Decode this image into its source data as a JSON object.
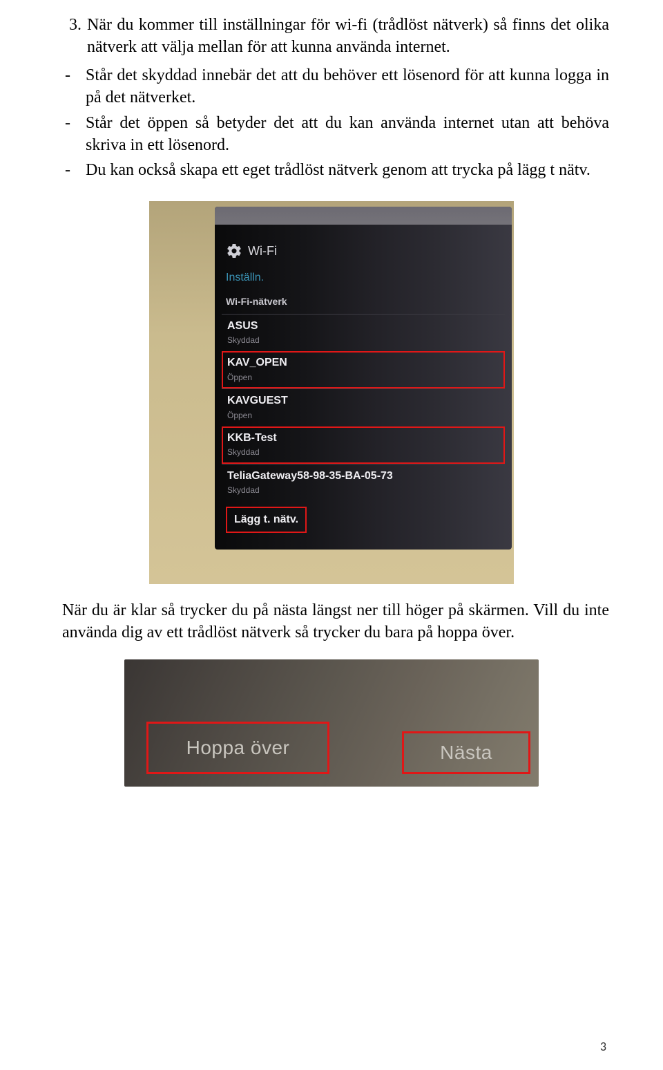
{
  "list": {
    "number": "3.",
    "item3_text": "När du kommer till inställningar för wi-fi (trådlöst nätverk) så finns det olika nätverk att välja mellan för att kunna använda internet.",
    "dash": "-",
    "bullet1": "Står det skyddad innebär det att du behöver ett lösenord för att kunna logga in på det nätverket.",
    "bullet2": "Står det öppen så betyder det att du kan använda internet utan att behöva skriva in ett lösenord.",
    "bullet3": "Du kan också skapa ett eget trådlöst nätverk genom att trycka på lägg t nätv."
  },
  "phone": {
    "wifi_title": "Wi-Fi",
    "install": "Inställn.",
    "section": "Wi-Fi-nätverk",
    "networks": [
      {
        "name": "ASUS",
        "status": "Skyddad"
      },
      {
        "name": "KAV_OPEN",
        "status": "Öppen"
      },
      {
        "name": "KAVGUEST",
        "status": "Öppen"
      },
      {
        "name": "KKB-Test",
        "status": "Skyddad"
      },
      {
        "name": "TeliaGateway58-98-35-BA-05-73",
        "status": "Skyddad"
      }
    ],
    "add_label": "Lägg t. nätv."
  },
  "lower_text": "När du är klar så trycker du på nästa längst ner till höger på skärmen. Vill du inte använda dig av ett trådlöst nätverk så trycker du bara på hoppa över.",
  "buttons": {
    "skip": "Hoppa över",
    "next": "Nästa"
  },
  "page_number": "3"
}
